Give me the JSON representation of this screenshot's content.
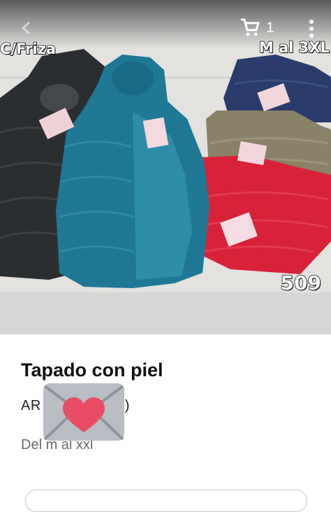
{
  "header": {
    "cart_count": "1",
    "icons": [
      "back-arrow-icon",
      "cart-icon",
      "kebab-menu-icon"
    ]
  },
  "photo": {
    "overlay_left": "C/Friza",
    "overlay_right": "M al 3XL",
    "overlay_number": "509"
  },
  "product": {
    "title": "Tapado con piel",
    "price_visible": "AR",
    "price_suffix_visible": ")",
    "description": "Del m al xxl"
  },
  "colors": {
    "jacket_black": "#2b2e31",
    "jacket_teal": "#1f7894",
    "jacket_navy": "#2a3c6b",
    "jacket_olive": "#8a8267",
    "jacket_red": "#d82238",
    "heart": "#e94c63",
    "envelope": "#b8bec4"
  }
}
